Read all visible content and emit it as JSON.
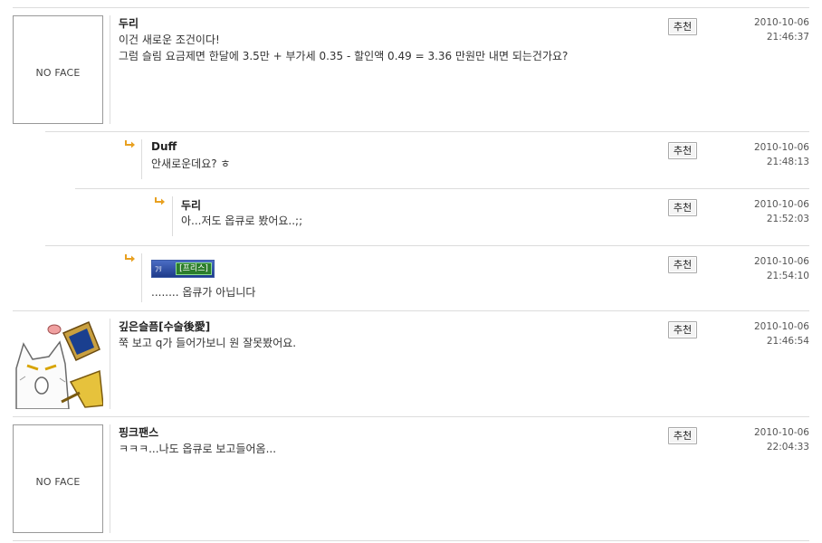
{
  "comments": [
    {
      "author": "두리",
      "lines": [
        "이건 새로운 조건이다!",
        "그럼 슬림 요금제면 한달에 3.5만 + 부가세 0.35 - 할인액 0.49 = 3.36 만원만 내면 되는건가요?"
      ],
      "date": "2010-10-06",
      "time": "21:46:37",
      "avatar": "NO FACE",
      "recommend": "추천"
    },
    {
      "author": "Duff",
      "lines": [
        "안새로운데요? ㅎ"
      ],
      "date": "2010-10-06",
      "time": "21:48:13",
      "recommend": "추천",
      "reply_icon": "reply-arrow-icon"
    },
    {
      "author": "두리",
      "lines": [
        "아...저도 옵큐로 봤어요..;;"
      ],
      "date": "2010-10-06",
      "time": "21:52:03",
      "recommend": "추천",
      "reply_icon": "reply-arrow-icon"
    },
    {
      "author_sticker": "[프리스]",
      "lines": [
        "........ 옵큐가 아닙니다"
      ],
      "date": "2010-10-06",
      "time": "21:54:10",
      "recommend": "추천",
      "reply_icon": "reply-arrow-icon"
    },
    {
      "author": "깊은슬픔[수술後愛]",
      "lines": [
        "쭉 보고 q가 들어가보니 원 잘못봤어요."
      ],
      "date": "2010-10-06",
      "time": "21:46:54",
      "avatar": "cat-with-computer-picture",
      "recommend": "추천"
    },
    {
      "author": "핑크팬스",
      "lines": [
        "ㅋㅋㅋ...나도 옵큐로 보고들어옴..."
      ],
      "date": "2010-10-06",
      "time": "22:04:33",
      "avatar": "NO FACE",
      "recommend": "추천"
    }
  ],
  "colors": {
    "divider": "#dcdcdc",
    "arrow": "#e8a020",
    "text": "#333333"
  }
}
